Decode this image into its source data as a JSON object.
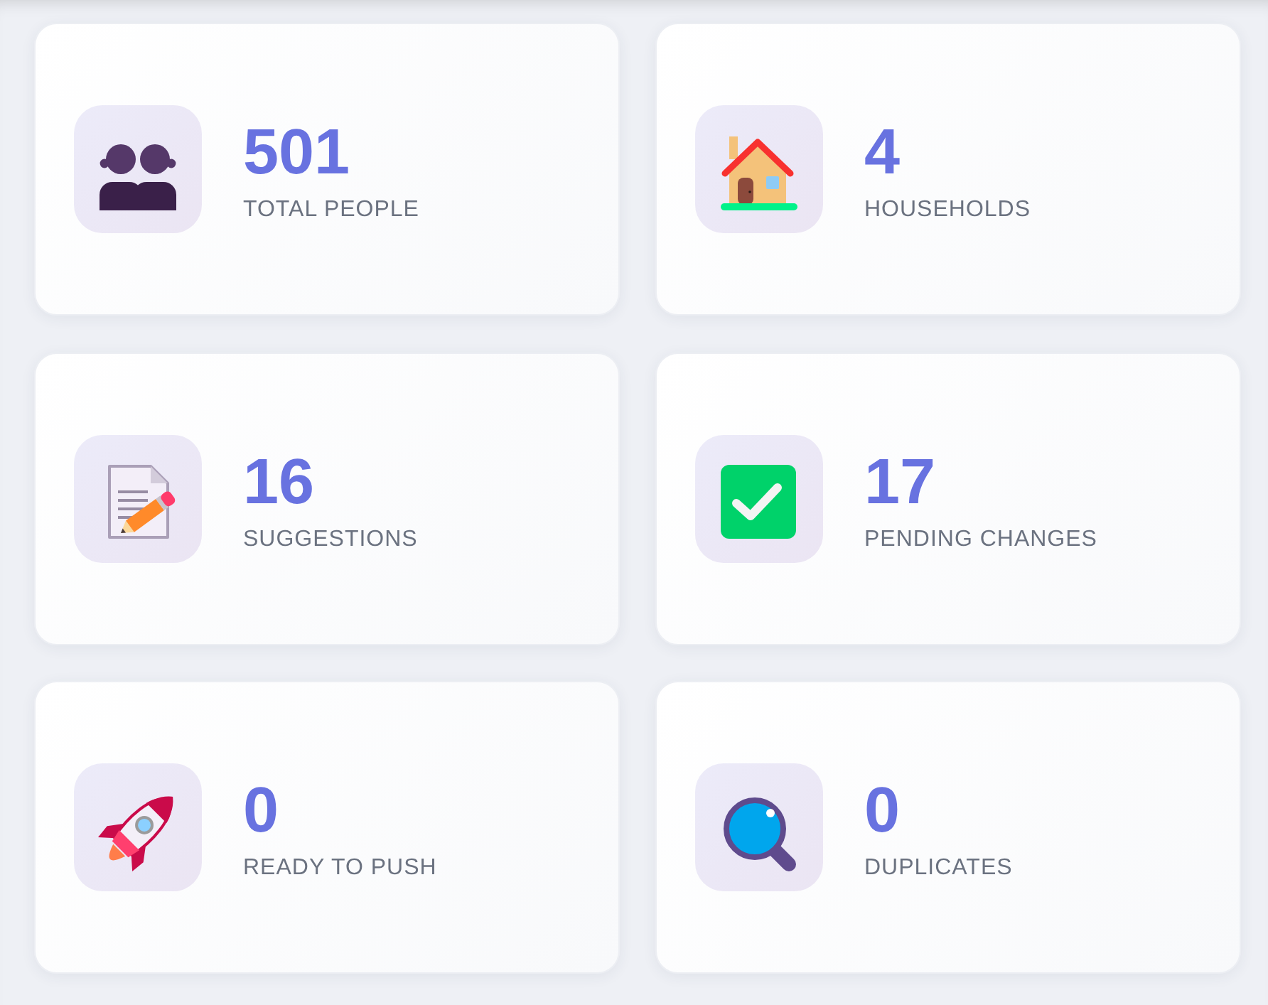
{
  "stats": [
    {
      "kind": "people",
      "value": "501",
      "label": "TOTAL PEOPLE"
    },
    {
      "kind": "house",
      "value": "4",
      "label": "HOUSEHOLDS"
    },
    {
      "kind": "document",
      "value": "16",
      "label": "SUGGESTIONS"
    },
    {
      "kind": "check",
      "value": "17",
      "label": "PENDING CHANGES"
    },
    {
      "kind": "rocket",
      "value": "0",
      "label": "READY TO PUSH"
    },
    {
      "kind": "search",
      "value": "0",
      "label": "DUPLICATES"
    }
  ]
}
